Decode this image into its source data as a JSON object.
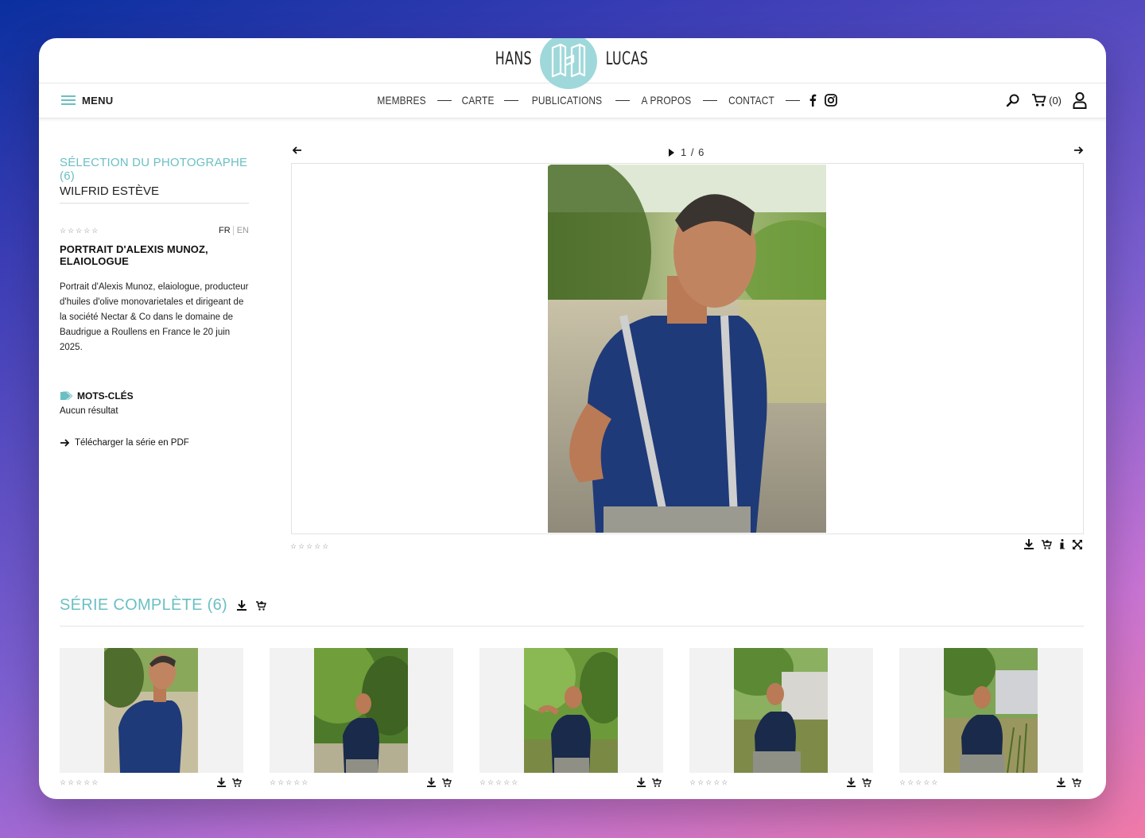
{
  "brand": {
    "left": "HANS",
    "right": "LUCAS"
  },
  "nav": {
    "menu_label": "MENU",
    "links": [
      "MEMBRES",
      "CARTE",
      "PUBLICATIONS",
      "A PROPOS",
      "CONTACT"
    ],
    "cart_count": "(0)"
  },
  "selection": {
    "title": "SÉLECTION DU PHOTOGRAPHE (6)",
    "author": "WILFRID ESTÈVE",
    "lang_fr": "FR",
    "lang_en": "EN",
    "stars": "☆☆☆☆☆",
    "photo_title": "PORTRAIT D'ALEXIS MUNOZ, ELAIOLOGUE",
    "description": "Portrait d'Alexis Munoz, elaiologue, producteur d'huiles d'olive monovarietales et dirigeant de la société Nectar & Co dans le domaine de Baudrigue a Roullens en France le 20 juin 2025.",
    "keywords_label": "MOTS-CLÉS",
    "keywords_value": "Aucun résultat",
    "pdf_link": "Télécharger la série en PDF"
  },
  "viewer": {
    "counter": "1 / 6",
    "stars": "☆☆☆☆☆"
  },
  "series": {
    "title": "SÉRIE COMPLÈTE (6)",
    "thumbs": [
      {
        "stars": "☆☆☆☆☆"
      },
      {
        "stars": "☆☆☆☆☆"
      },
      {
        "stars": "☆☆☆☆☆"
      },
      {
        "stars": "☆☆☆☆☆"
      },
      {
        "stars": "☆☆☆☆☆"
      }
    ]
  },
  "colors": {
    "accent": "#6bbfc3",
    "logo_bg": "#9fd8da"
  },
  "icons": [
    "hamburger-icon",
    "facebook-icon",
    "instagram-icon",
    "search-icon",
    "cart-icon",
    "user-icon",
    "arrow-left-icon",
    "arrow-right-icon",
    "play-icon",
    "download-icon",
    "add-to-cart-icon",
    "info-icon",
    "fullscreen-icon",
    "tag-icon"
  ]
}
